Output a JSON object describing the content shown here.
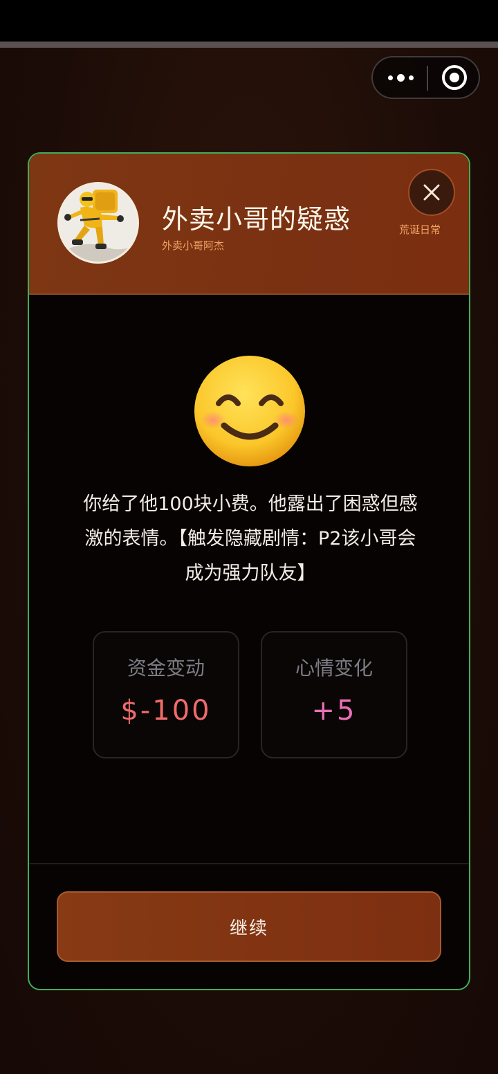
{
  "capsule": {
    "more_icon": "more-dots-icon",
    "close_icon": "target-circle-icon"
  },
  "dialog": {
    "title": "外卖小哥的疑惑",
    "subtitle": "外卖小哥阿杰",
    "tag": "荒诞日常",
    "close_icon": "close-icon",
    "avatar": "delivery-courier-avatar",
    "emoji": "smiling-face-with-smiling-eyes",
    "story": "你给了他100块小费。他露出了困惑但感激的表情。【触发隐藏剧情：P2该小哥会成为强力队友】",
    "stats": [
      {
        "label": "资金变动",
        "value": "$-100"
      },
      {
        "label": "心情变化",
        "value": "+5"
      }
    ],
    "continue_label": "继续"
  },
  "colors": {
    "accent": "#7e3713",
    "border": "#3fae5a",
    "money": "#f06b6b",
    "mood": "#ea6fb6"
  }
}
